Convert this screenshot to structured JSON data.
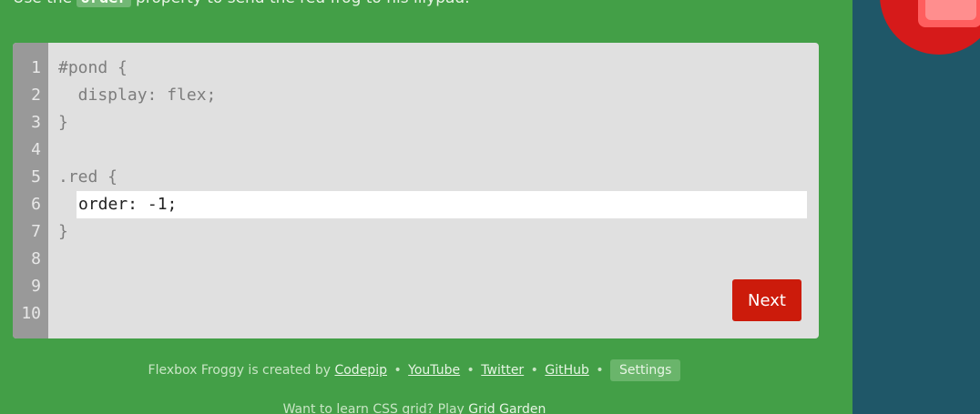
{
  "instruction": {
    "prefix": "Use the ",
    "code": "order",
    "suffix": " property to send the red frog to his lilypad."
  },
  "editor": {
    "line_numbers": [
      "1",
      "2",
      "3",
      "4",
      "5",
      "6",
      "7",
      "8",
      "9",
      "10"
    ],
    "lines": [
      "#pond {",
      "  display: flex;",
      "}",
      "",
      ".red {",
      "",
      "}",
      "",
      "",
      ""
    ],
    "input_value": "order: -1;"
  },
  "next_label": "Next",
  "footer": {
    "created_by": "Flexbox Froggy is created by",
    "codepip": "Codepip",
    "youtube": "YouTube",
    "twitter": "Twitter",
    "github": "GitHub",
    "bullet": "•",
    "settings": "Settings"
  },
  "footer2": {
    "text": "Want to learn CSS grid? Play ",
    "link": "Grid Garden"
  },
  "colors": {
    "background": "#439f47",
    "editor_bg": "#e0e0e0",
    "gutter": "#999999",
    "next_button": "#cc1b0b",
    "side_panel": "#1f5768",
    "frog": "#d61a1a"
  }
}
